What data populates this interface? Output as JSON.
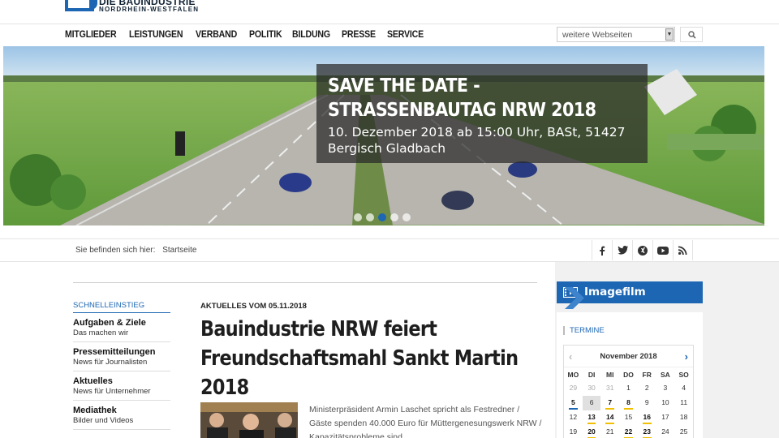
{
  "logo": {
    "line1": "DIE BAUINDUSTRIE",
    "line2": "NORDRHEIN-WESTFALEN"
  },
  "nav": [
    "MITGLIEDER",
    "LEISTUNGEN",
    "VERBAND",
    "POLITIK",
    "BILDUNG",
    "PRESSE",
    "SERVICE"
  ],
  "site_select": {
    "value": "weitere Webseiten"
  },
  "hero": {
    "title": "SAVE THE DATE - STRASSENBAUTAG NRW 2018",
    "subtitle": "10. Dezember 2018 ab 15:00 Uhr, BASt, 51427 Bergisch Gladbach",
    "slides": 5,
    "active_slide": 3
  },
  "breadcrumb": {
    "prefix": "Sie befinden sich hier:",
    "current": "Startseite"
  },
  "social_icons": [
    "facebook-icon",
    "twitter-icon",
    "xing-icon",
    "youtube-icon",
    "rss-icon"
  ],
  "quick": {
    "heading": "SCHNELLEINSTIEG",
    "items": [
      {
        "title": "Aufgaben & Ziele",
        "sub": "Das machen wir"
      },
      {
        "title": "Pressemitteilungen",
        "sub": "News für Journalisten"
      },
      {
        "title": "Aktuelles",
        "sub": "News für Unternehmer"
      },
      {
        "title": "Mediathek",
        "sub": "Bilder und Videos"
      }
    ]
  },
  "article": {
    "kicker": "AKTUELLES VOM 05.11.2018",
    "headline": "Bauindustrie NRW feiert Freundschaftsmahl Sankt Martin 2018",
    "teaser": "Ministerpräsident Armin Laschet spricht als Festredner / Gäste spenden 40.000 Euro für Müttergenesungswerk NRW / Kapazitätsprobleme sind"
  },
  "imagefilm": {
    "label": "Imagefilm"
  },
  "termine": {
    "label": "TERMINE",
    "month": "November 2018",
    "weekdays": [
      "MO",
      "DI",
      "MI",
      "DO",
      "FR",
      "SA",
      "SO"
    ],
    "days": [
      {
        "n": "29",
        "other": true
      },
      {
        "n": "30",
        "other": true
      },
      {
        "n": "31",
        "other": true
      },
      {
        "n": "1"
      },
      {
        "n": "2"
      },
      {
        "n": "3"
      },
      {
        "n": "4"
      },
      {
        "n": "5",
        "bold": true,
        "event": "blue"
      },
      {
        "n": "6",
        "today": true
      },
      {
        "n": "7",
        "bold": true,
        "event": "yellow"
      },
      {
        "n": "8",
        "bold": true,
        "event": "yellow"
      },
      {
        "n": "9"
      },
      {
        "n": "10"
      },
      {
        "n": "11"
      },
      {
        "n": "12"
      },
      {
        "n": "13",
        "bold": true,
        "event": "yellow"
      },
      {
        "n": "14",
        "bold": true,
        "event": "yellow"
      },
      {
        "n": "15"
      },
      {
        "n": "16",
        "bold": true,
        "event": "yellow"
      },
      {
        "n": "17"
      },
      {
        "n": "18"
      },
      {
        "n": "19"
      },
      {
        "n": "20",
        "bold": true,
        "event": "yellow"
      },
      {
        "n": "21"
      },
      {
        "n": "22",
        "bold": true,
        "event": "yellow"
      },
      {
        "n": "23",
        "bold": true,
        "event": "yellow"
      },
      {
        "n": "24"
      },
      {
        "n": "25"
      }
    ]
  },
  "colors": {
    "brand": "#1d66b3",
    "event": "#f0c000"
  }
}
